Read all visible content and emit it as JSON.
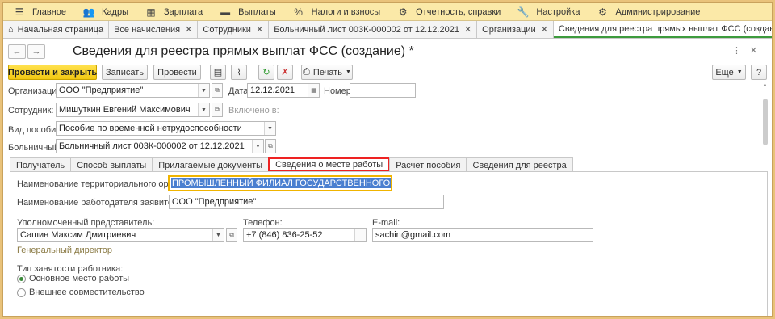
{
  "menu": {
    "items": [
      {
        "label": "Главное",
        "icon": "hamburger-icon"
      },
      {
        "label": "Кадры",
        "icon": "people-icon"
      },
      {
        "label": "Зарплата",
        "icon": "calculator-icon"
      },
      {
        "label": "Выплаты",
        "icon": "wallet-icon"
      },
      {
        "label": "Налоги и взносы",
        "icon": "percent-icon"
      },
      {
        "label": "Отчетность, справки",
        "icon": "gear-report-icon"
      },
      {
        "label": "Настройка",
        "icon": "wrench-icon"
      },
      {
        "label": "Администрирование",
        "icon": "gear-icon"
      }
    ]
  },
  "window_tabs": [
    {
      "label": "Начальная страница"
    },
    {
      "label": "Все начисления"
    },
    {
      "label": "Сотрудники"
    },
    {
      "label": "Больничный лист 003К-000002 от 12.12.2021"
    },
    {
      "label": "Организации"
    },
    {
      "label": "Сведения для реестра прямых выплат ФСС (создание) *"
    }
  ],
  "document": {
    "title": "Сведения для реестра прямых выплат ФСС (создание) *"
  },
  "toolbar": {
    "post_close": "Провести и закрыть",
    "save": "Записать",
    "post": "Провести",
    "print": "Печать",
    "more": "Еще",
    "help": "?"
  },
  "form": {
    "org_label": "Организация:",
    "org_value": "ООО \"Предприятие\"",
    "date_label": "Дата:",
    "date_value": "12.12.2021",
    "number_label": "Номер:",
    "number_value": "",
    "employee_label": "Сотрудник:",
    "employee_value": "Мишуткин Евгений Максимович",
    "included_label": "Включено в:",
    "benefit_label": "Вид пособия:",
    "benefit_value": "Пособие по временной нетрудоспособности",
    "sick_label": "Больничный:",
    "sick_value": "Больничный лист 003К-000002 от 12.12.2021"
  },
  "inner_tabs": [
    {
      "label": "Получатель"
    },
    {
      "label": "Способ выплаты"
    },
    {
      "label": "Прилагаемые документы"
    },
    {
      "label": "Сведения о месте работы"
    },
    {
      "label": "Расчет пособия"
    },
    {
      "label": "Сведения для реестра"
    }
  ],
  "workplace": {
    "fss_label": "Наименование территориального органа ФСС:",
    "fss_value": "ПРОМЫШЛЕННЫЙ ФИЛИАЛ ГОСУДАРСТВЕННОГО УЧРЕЖДЕНИ",
    "employer_label": "Наименование работодателя заявителя:",
    "employer_value": "ООО \"Предприятие\"",
    "rep_label": "Уполномоченный представитель:",
    "rep_value": "Сашин Максим Дмитриевич",
    "rep_position": "Генеральный директор",
    "phone_label": "Телефон:",
    "phone_value": "+7 (846) 836-25-52",
    "email_label": "E-mail:",
    "email_value": "sachin@gmail.com",
    "employment_label": "Тип занятости работника:",
    "employment_options": [
      {
        "label": "Основное место работы",
        "selected": true
      },
      {
        "label": "Внешнее совместительство",
        "selected": false
      }
    ]
  },
  "colors": {
    "menubar": "#fbe9a8",
    "primary_button": "#f2c811",
    "active_tab_highlight": "#e22222",
    "selection": "#4a7fd0",
    "frame": "#e9c27a"
  }
}
